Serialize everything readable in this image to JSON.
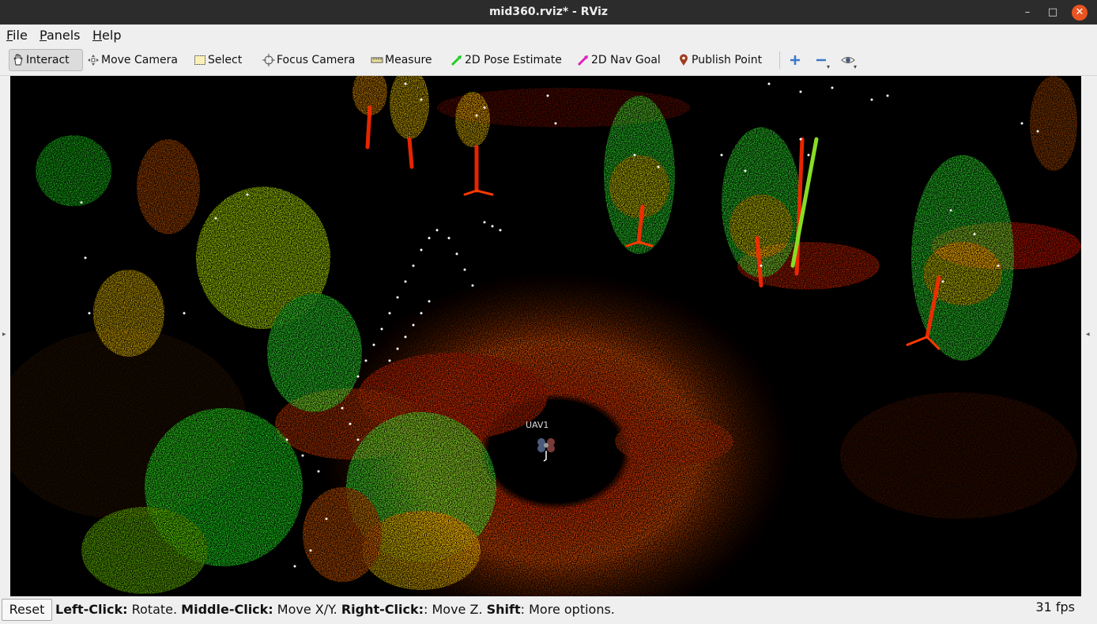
{
  "window": {
    "title": "mid360.rviz* - RViz",
    "minimize_glyph": "–",
    "maximize_glyph": "□",
    "close_glyph": "✕"
  },
  "menu": {
    "file": {
      "accel": "F",
      "rest": "ile"
    },
    "panels": {
      "accel": "P",
      "rest": "anels"
    },
    "help": {
      "accel": "H",
      "rest": "elp"
    }
  },
  "toolbar": {
    "interact": "Interact",
    "move_camera": "Move Camera",
    "select": "Select",
    "focus_camera": "Focus Camera",
    "measure": "Measure",
    "pose_estimate": "2D Pose Estimate",
    "nav_goal": "2D Nav Goal",
    "publish_point": "Publish Point",
    "icons": [
      "hand-icon",
      "move-camera-icon",
      "select-icon",
      "focus-camera-icon",
      "ruler-icon",
      "pose-arrow-icon",
      "nav-goal-arrow-icon",
      "map-pin-icon",
      "plus-icon",
      "minus-icon",
      "eye-icon"
    ],
    "accent_colors": {
      "pose_estimate": "#22cc22",
      "nav_goal": "#e020c0",
      "publish_point": "#a03c20",
      "plus_minus": "#3a78c8"
    }
  },
  "viewport": {
    "marker_label": "UAV1",
    "background": "#000000",
    "palette": [
      "#ff2a00",
      "#ff5a00",
      "#ff8c00",
      "#ffd000",
      "#aaff00",
      "#33ff33",
      "#ffffff"
    ]
  },
  "status": {
    "reset": "Reset",
    "hints": [
      {
        "key": "Left-Click:",
        "action": " Rotate. "
      },
      {
        "key": "Middle-Click:",
        "action": " Move X/Y. "
      },
      {
        "key": "Right-Click:",
        "action": ": Move Z. "
      },
      {
        "key": "Shift",
        "action": ": More options."
      }
    ],
    "fps": "31 fps"
  }
}
